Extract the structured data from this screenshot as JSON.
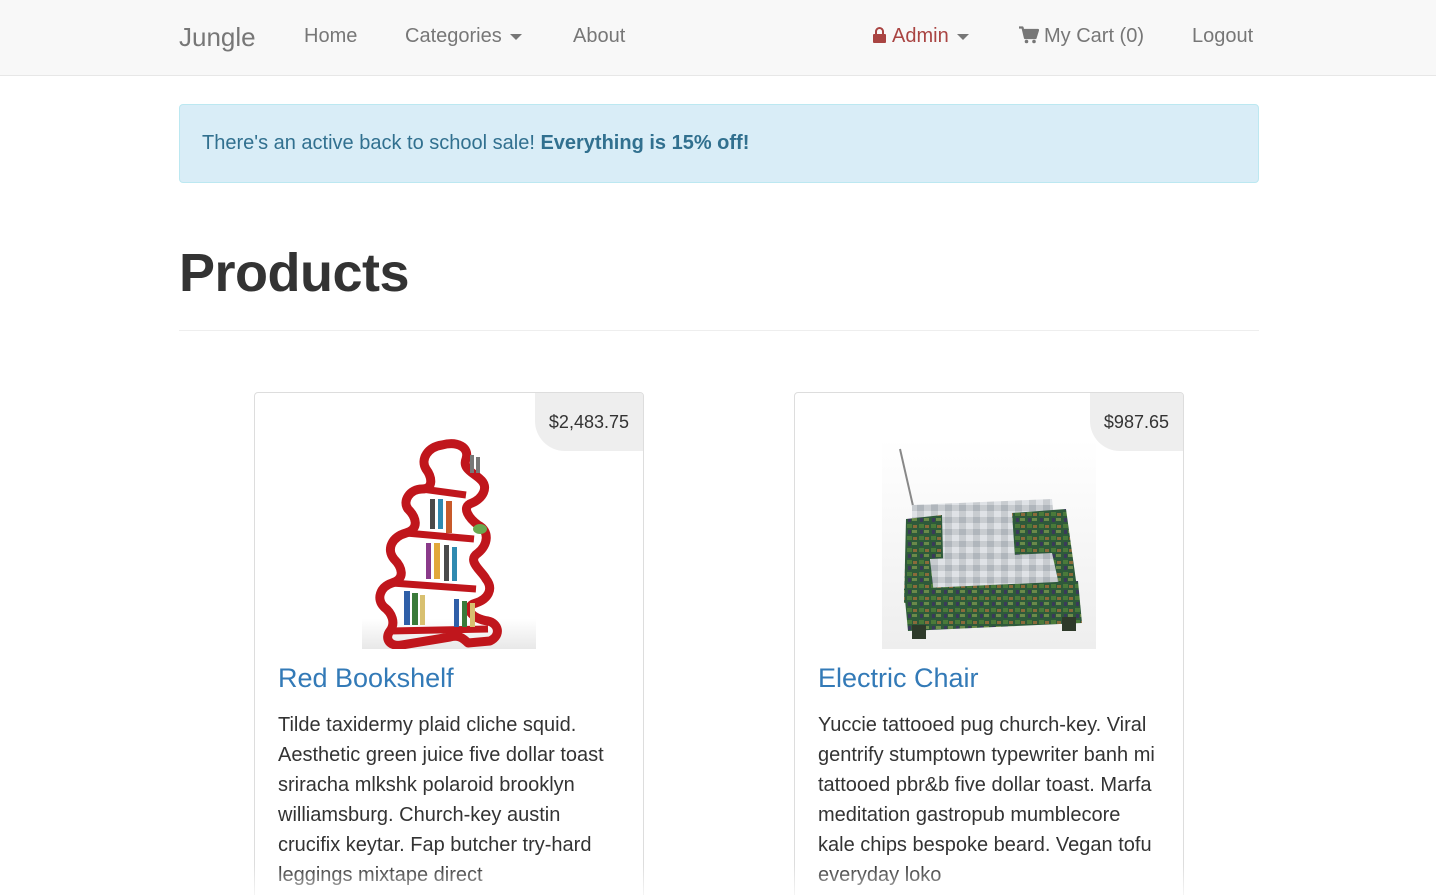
{
  "navbar": {
    "brand": "Jungle",
    "home": "Home",
    "categories": "Categories",
    "about": "About",
    "admin": "Admin",
    "cart": "My Cart (0)",
    "logout": "Logout"
  },
  "alert": {
    "text": "There's an active back to school sale! ",
    "emphasis": "Everything is 15% off!"
  },
  "page": {
    "title": "Products"
  },
  "products": [
    {
      "name": "Red Bookshelf",
      "price": "$2,483.75",
      "description": "Tilde taxidermy plaid cliche squid. Aesthetic green juice five dollar toast sriracha mlkshk polaroid brooklyn williamsburg. Church-key austin crucifix keytar. Fap butcher try-hard leggings mixtape direct",
      "image_icon": "red-bookshelf-image"
    },
    {
      "name": "Electric Chair",
      "price": "$987.65",
      "description": "Yuccie tattooed pug church-key. Viral gentrify stumptown typewriter banh mi tattooed pbr&b five dollar toast. Marfa meditation gastropub mumblecore kale chips bespoke beard. Vegan tofu everyday loko",
      "image_icon": "electric-chair-image"
    }
  ],
  "colors": {
    "navbar_bg": "#f8f8f8",
    "link": "#337ab7",
    "admin": "#a94442",
    "alert_bg": "#d9edf7",
    "alert_text": "#31708f"
  }
}
